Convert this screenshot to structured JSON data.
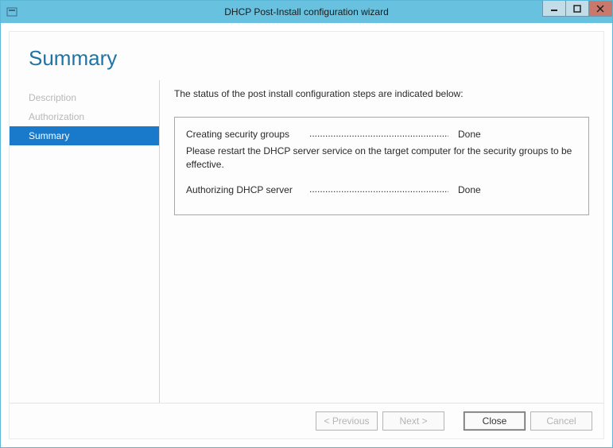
{
  "titlebar": {
    "title": "DHCP Post-Install configuration wizard"
  },
  "page": {
    "heading": "Summary"
  },
  "sidebar": {
    "items": [
      {
        "label": "Description",
        "active": false
      },
      {
        "label": "Authorization",
        "active": false
      },
      {
        "label": "Summary",
        "active": true
      }
    ]
  },
  "main": {
    "intro": "The status of the post install configuration steps are indicated below:",
    "steps": [
      {
        "label": "Creating security groups",
        "result": "Done",
        "note": "Please restart the DHCP server service on the target computer for the security groups to be effective."
      },
      {
        "label": "Authorizing DHCP server",
        "result": "Done"
      }
    ]
  },
  "footer": {
    "previous": "< Previous",
    "next": "Next >",
    "close": "Close",
    "cancel": "Cancel"
  }
}
